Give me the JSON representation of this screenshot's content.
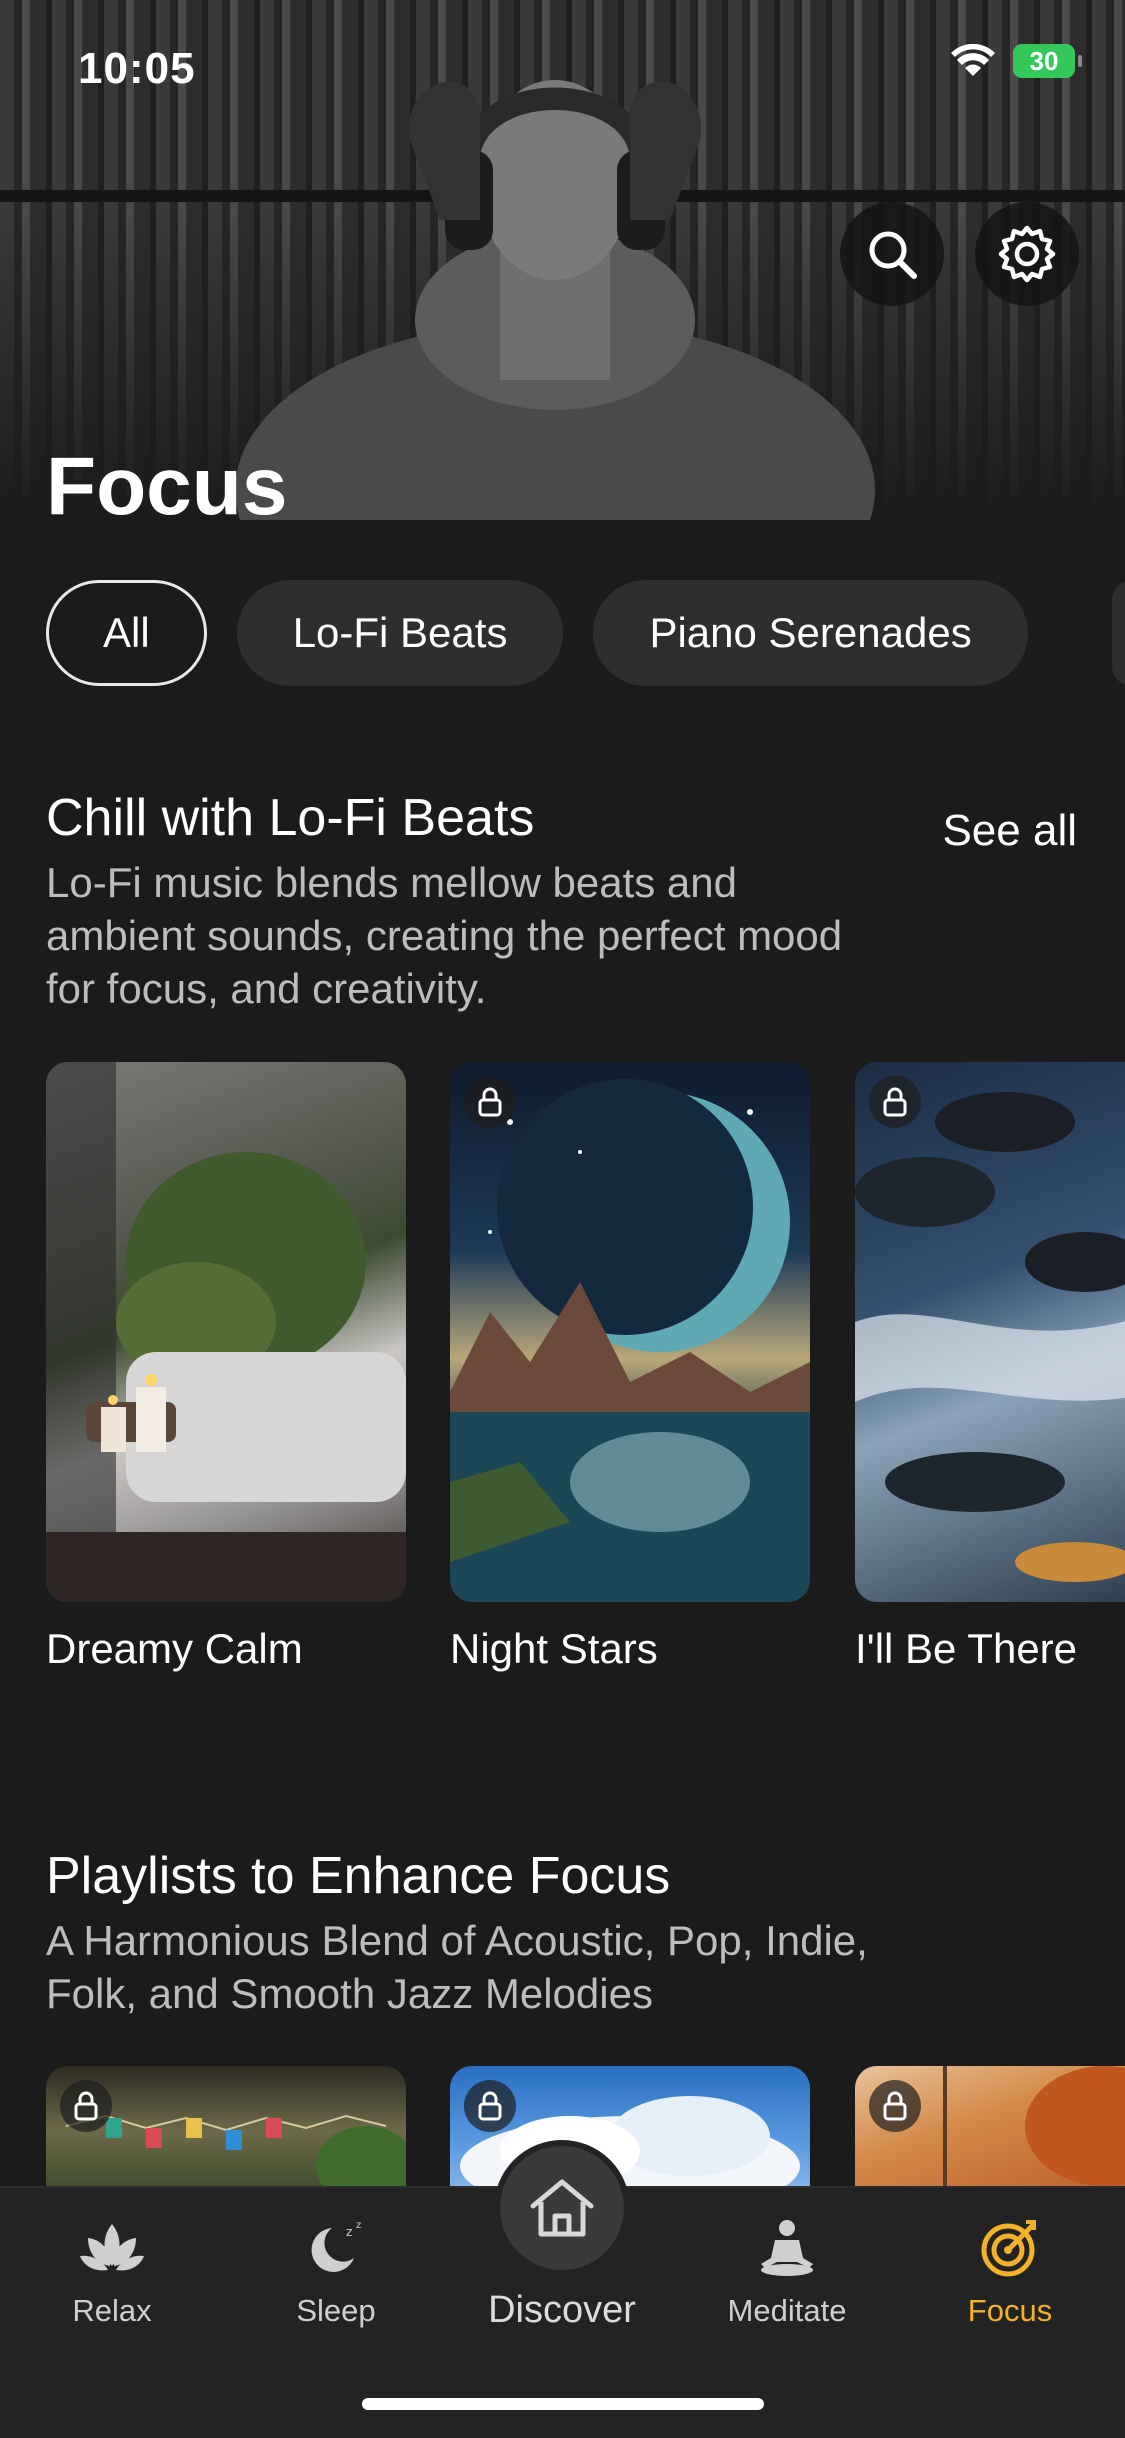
{
  "status": {
    "time": "10:05",
    "battery": "30"
  },
  "header": {
    "title": "Focus"
  },
  "chips": [
    "All",
    "Lo-Fi Beats",
    "Piano Serenades"
  ],
  "section1": {
    "title": "Chill with Lo-Fi Beats",
    "description": "Lo-Fi music blends mellow beats and ambient sounds, creating the perfect mood for focus, and creativity.",
    "see_all": "See all",
    "cards": [
      {
        "label": "Dreamy Calm",
        "locked": false
      },
      {
        "label": "Night Stars",
        "locked": true
      },
      {
        "label": "I'll Be There",
        "locked": true
      }
    ]
  },
  "section2": {
    "title": "Playlists to Enhance Focus",
    "description": "A Harmonious Blend of Acoustic, Pop, Indie, Folk, and Smooth Jazz Melodies"
  },
  "tabs": {
    "relax": "Relax",
    "sleep": "Sleep",
    "discover": "Discover",
    "meditate": "Meditate",
    "focus": "Focus"
  },
  "colors": {
    "accent": "#f2b229",
    "battery": "#34c759",
    "background": "#1b1b1b"
  }
}
